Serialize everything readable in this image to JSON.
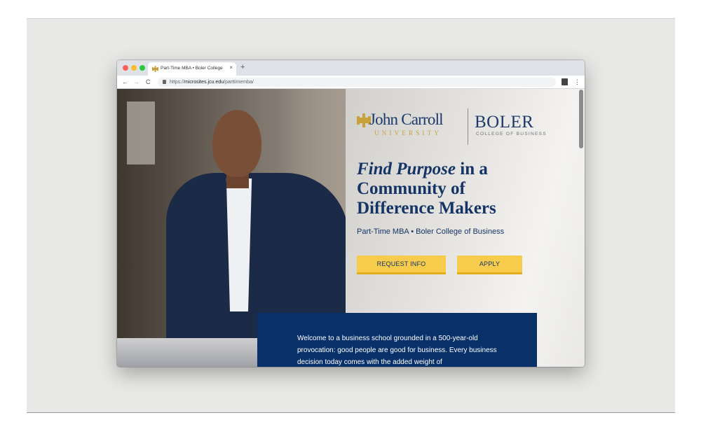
{
  "browser": {
    "tab_title": "Part-Time MBA • Boler College",
    "tab_close": "×",
    "new_tab": "+",
    "url_scheme": "https://",
    "url_host": "microsites.jcu.edu",
    "url_path": "/parttimemba/",
    "nav_back": "←",
    "nav_forward": "→",
    "nav_reload": "C",
    "menu": "⋮"
  },
  "logo": {
    "primary": "John Carroll",
    "primary_sub": "UNIVERSITY",
    "secondary": "BOLER",
    "secondary_sub": "COLLEGE OF BUSINESS",
    "gold": "#c8a13b",
    "navy": "#1d3a6b"
  },
  "hero": {
    "headline_em": "Find Purpose",
    "headline_rest_1": " in a",
    "headline_line_2": "Community of",
    "headline_line_3": "Difference Makers",
    "subhead": "Part-Time MBA • Boler College of Business"
  },
  "buttons": {
    "request_info": "REQUEST INFO",
    "apply": "APPLY",
    "color": "#f7cc4c"
  },
  "welcome": {
    "text": "Welcome to a business school grounded in a 500-year-old provocation: good people are good for business. Every business decision today comes with the added weight of",
    "background": "#08316a"
  },
  "icons": {
    "favicon": "jcu-cross-icon",
    "lock": "lock-icon",
    "profile": "profile-icon",
    "menu": "kebab-menu-icon"
  }
}
